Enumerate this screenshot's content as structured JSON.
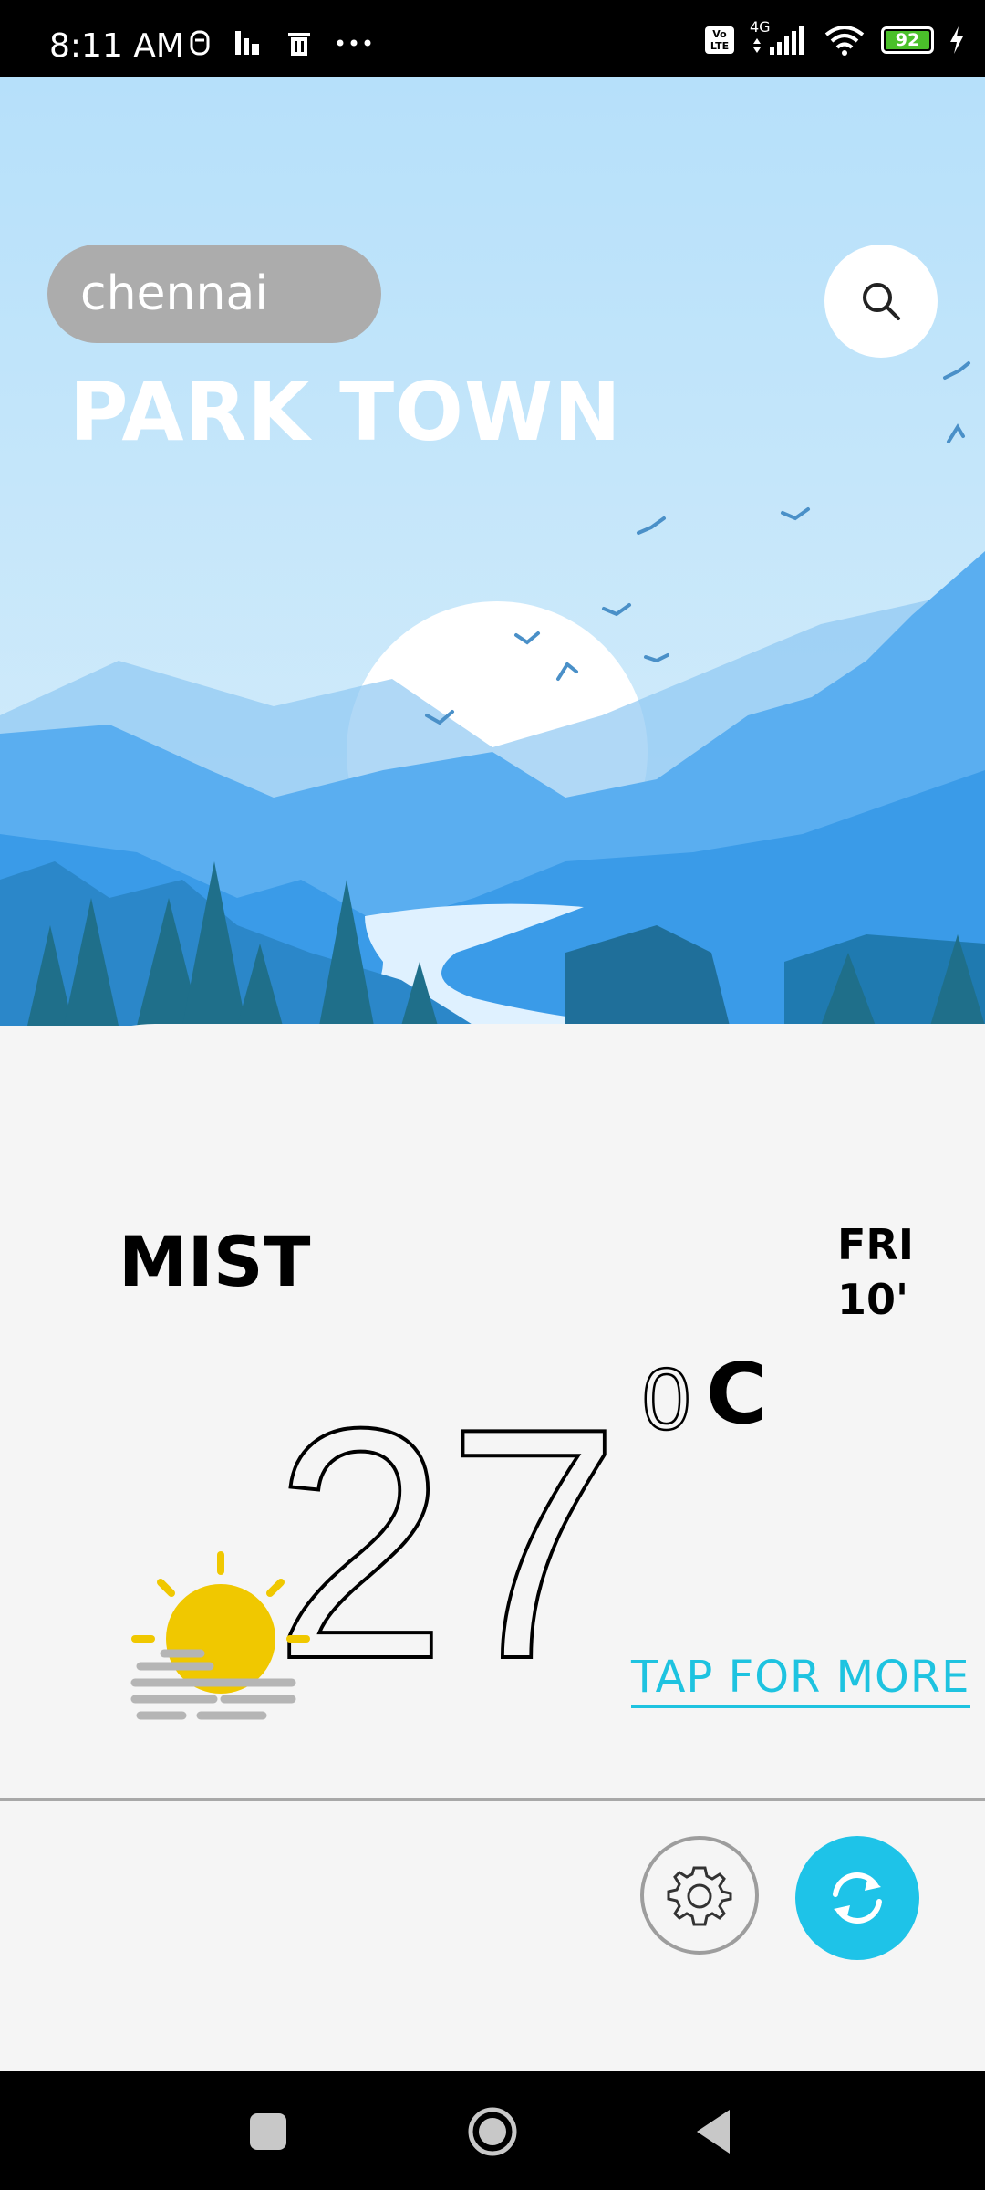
{
  "status_bar": {
    "time": "8:11 AM",
    "network": "4G",
    "volte": "Vo LTE",
    "battery": "92",
    "battery_level": 0.92
  },
  "search": {
    "value": "chennai"
  },
  "location": {
    "name": "PARK TOWN"
  },
  "weather": {
    "condition": "MIST",
    "day": "FRI",
    "date": "10'",
    "temperature": "27",
    "degree_symbol": "0",
    "unit": "C",
    "icon": "sun-mist-icon"
  },
  "actions": {
    "tap_more": "TAP FOR MORE"
  },
  "colors": {
    "accent": "#1ec3e8",
    "sky_top": "#b6e0fa",
    "mountain": "#3a9be8",
    "sun": "#f0c800"
  }
}
